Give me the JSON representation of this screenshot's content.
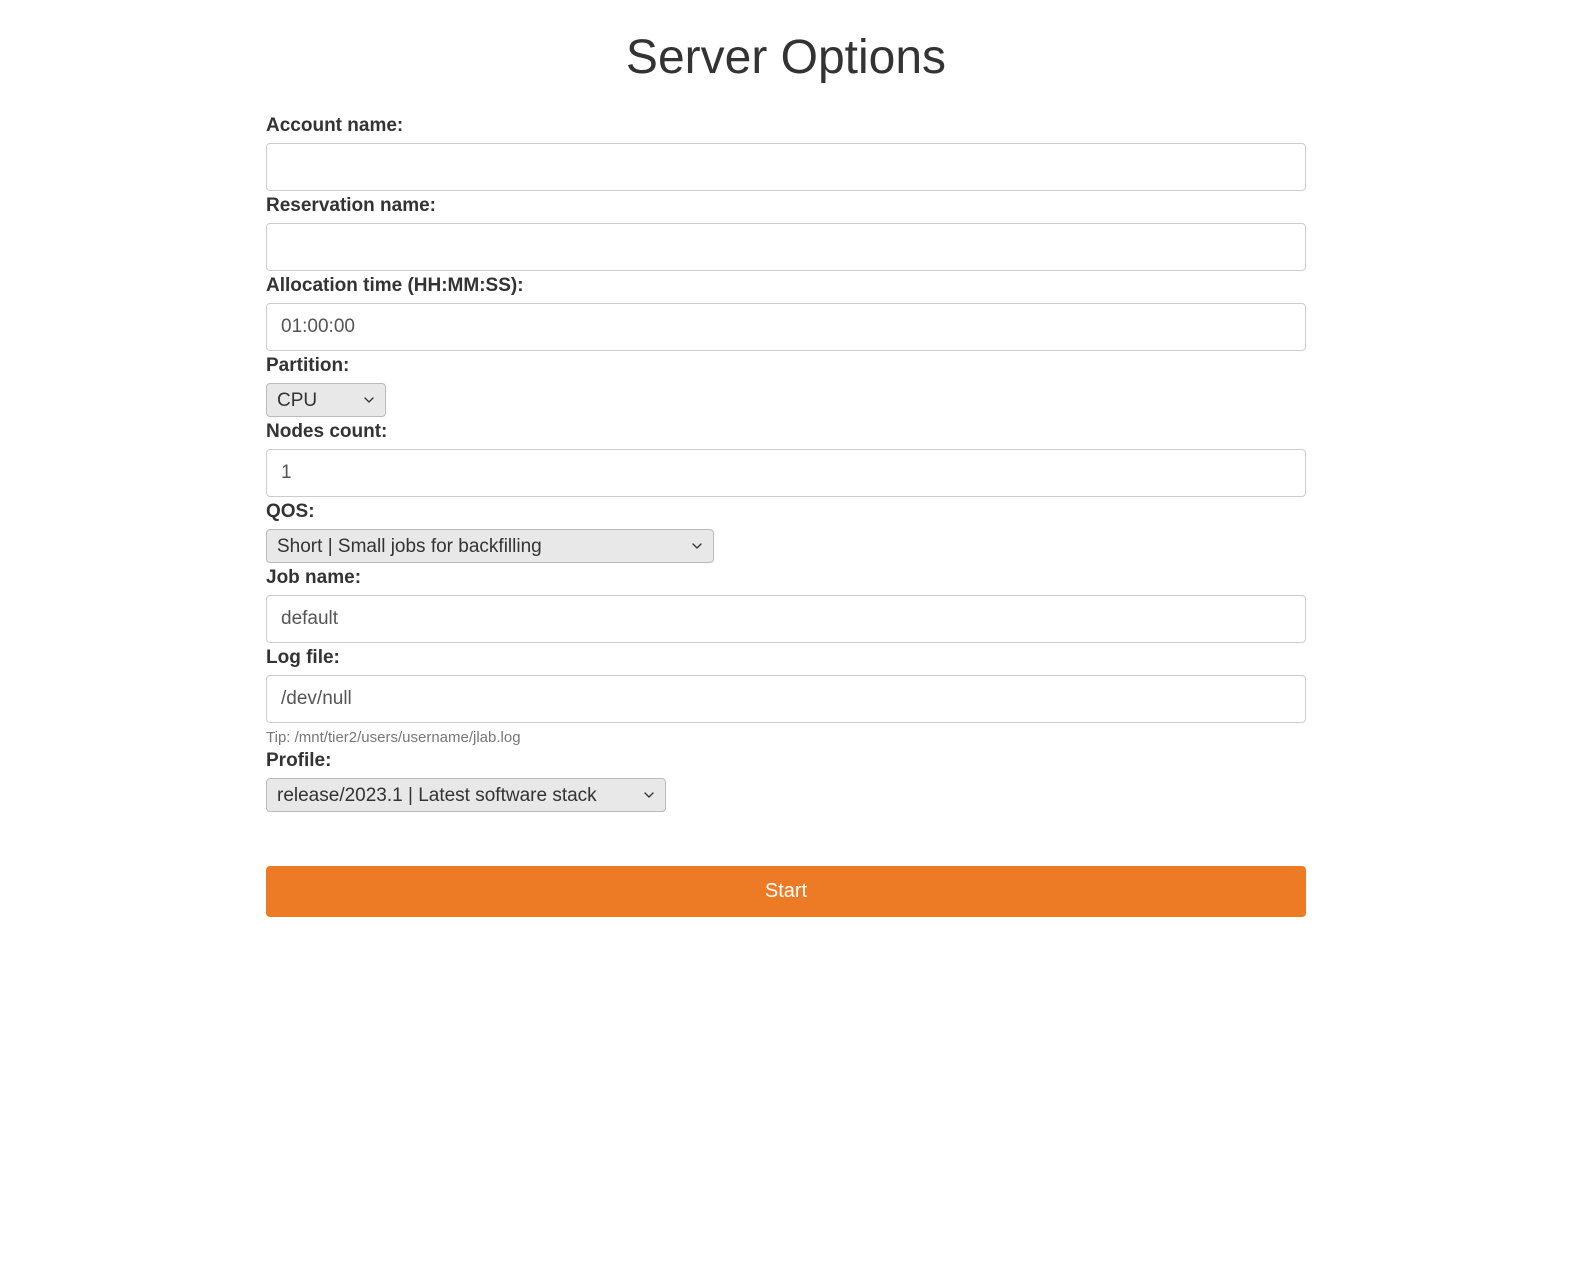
{
  "title": "Server Options",
  "form": {
    "account_name": {
      "label": "Account name:",
      "value": ""
    },
    "reservation_name": {
      "label": "Reservation name:",
      "value": ""
    },
    "allocation_time": {
      "label": "Allocation time (HH:MM:SS):",
      "value": "01:00:00"
    },
    "partition": {
      "label": "Partition:",
      "selected": "CPU"
    },
    "nodes_count": {
      "label": "Nodes count:",
      "value": "1"
    },
    "qos": {
      "label": "QOS:",
      "selected": "Short | Small jobs for backfilling"
    },
    "job_name": {
      "label": "Job name:",
      "value": "default"
    },
    "log_file": {
      "label": "Log file:",
      "value": "/dev/null",
      "help": "Tip: /mnt/tier2/users/username/jlab.log"
    },
    "profile": {
      "label": "Profile:",
      "selected": "release/2023.1 | Latest software stack"
    }
  },
  "submit_label": "Start"
}
